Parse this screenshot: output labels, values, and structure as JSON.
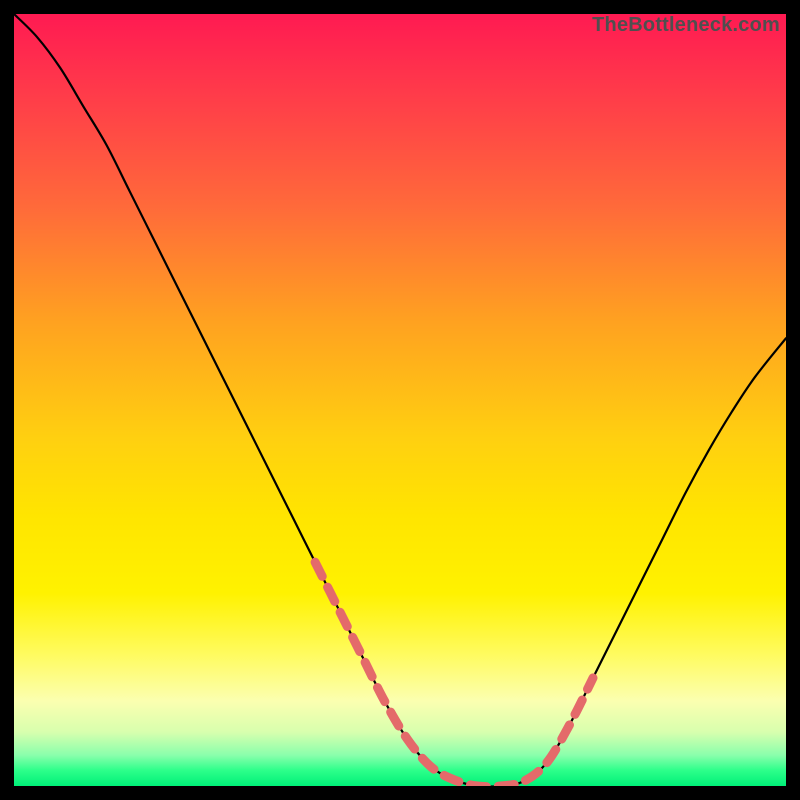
{
  "watermark": "TheBottleneck.com",
  "colors": {
    "frame": "#000000",
    "curve_stroke": "#000000",
    "dash_stroke": "#e46a6a",
    "gradient_top": "#ff1a52",
    "gradient_bottom": "#00f078"
  },
  "chart_data": {
    "type": "line",
    "title": "",
    "xlabel": "",
    "ylabel": "",
    "xlim": [
      0,
      100
    ],
    "ylim": [
      0,
      100
    ],
    "series": [
      {
        "name": "bottleneck-curve",
        "x": [
          0,
          3,
          6,
          9,
          12,
          15,
          18,
          21,
          24,
          27,
          30,
          33,
          36,
          39,
          42,
          45,
          48,
          51,
          54,
          57,
          60,
          63,
          66,
          69,
          72,
          75,
          78,
          81,
          84,
          87,
          90,
          93,
          96,
          100
        ],
        "values": [
          100,
          97,
          93,
          88,
          83,
          77,
          71,
          65,
          59,
          53,
          47,
          41,
          35,
          29,
          23,
          17,
          11,
          6,
          2.5,
          0.8,
          0,
          0,
          0.6,
          3,
          8,
          14,
          20,
          26,
          32,
          38,
          43.5,
          48.5,
          53,
          58
        ]
      },
      {
        "name": "optimal-range-dash",
        "x": [
          39,
          42,
          45,
          48,
          51,
          54,
          57,
          60,
          63,
          66,
          69,
          72,
          75
        ],
        "values": [
          29,
          23,
          17,
          11,
          6,
          2.5,
          0.8,
          0,
          0,
          0.6,
          3,
          8,
          14
        ]
      }
    ],
    "annotations": []
  }
}
